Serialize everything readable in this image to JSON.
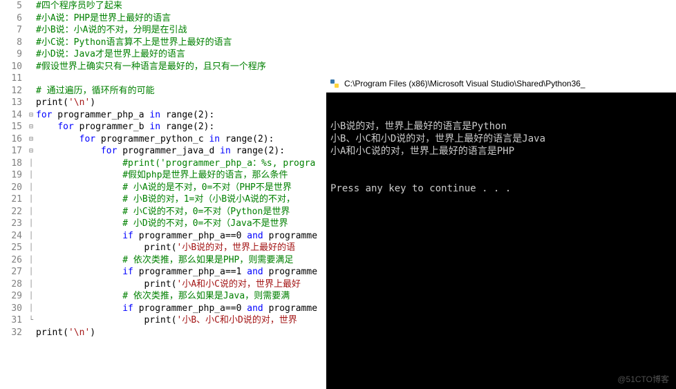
{
  "editor": {
    "lines": [
      {
        "num": 5,
        "fold": "",
        "seg": [
          {
            "cls": "c",
            "t": "#四个程序员吵了起来"
          }
        ]
      },
      {
        "num": 6,
        "fold": "",
        "seg": [
          {
            "cls": "c",
            "t": "#小A说：PHP是世界上最好的语言"
          }
        ]
      },
      {
        "num": 7,
        "fold": "",
        "seg": [
          {
            "cls": "c",
            "t": "#小B说：小A说的不对，分明是在引战"
          }
        ]
      },
      {
        "num": 8,
        "fold": "",
        "seg": [
          {
            "cls": "c",
            "t": "#小C说：Python语言算不上是世界上最好的语言"
          }
        ]
      },
      {
        "num": 9,
        "fold": "",
        "seg": [
          {
            "cls": "c",
            "t": "#小D说：Java才是世界上最好的语言"
          }
        ]
      },
      {
        "num": 10,
        "fold": "",
        "seg": [
          {
            "cls": "c",
            "t": "#假设世界上确实只有一种语言是最好的，且只有一个程序"
          }
        ]
      },
      {
        "num": 11,
        "fold": "",
        "seg": []
      },
      {
        "num": 12,
        "fold": "",
        "seg": [
          {
            "cls": "c",
            "t": "# 通过遍历，循环所有的可能"
          }
        ]
      },
      {
        "num": 13,
        "fold": "",
        "seg": [
          {
            "cls": "f",
            "t": "print"
          },
          {
            "cls": "op",
            "t": "("
          },
          {
            "cls": "s",
            "t": "'\\n'"
          },
          {
            "cls": "op",
            "t": ")"
          }
        ]
      },
      {
        "num": 14,
        "fold": "⊟",
        "seg": [
          {
            "cls": "k",
            "t": "for"
          },
          {
            "cls": "n",
            "t": " programmer_php_a "
          },
          {
            "cls": "k",
            "t": "in"
          },
          {
            "cls": "n",
            "t": " range"
          },
          {
            "cls": "op",
            "t": "("
          },
          {
            "cls": "num",
            "t": "2"
          },
          {
            "cls": "op",
            "t": "):"
          }
        ]
      },
      {
        "num": 15,
        "fold": "⊟",
        "seg": [
          {
            "cls": "n",
            "t": "    "
          },
          {
            "cls": "k",
            "t": "for"
          },
          {
            "cls": "n",
            "t": " programmer_b "
          },
          {
            "cls": "k",
            "t": "in"
          },
          {
            "cls": "n",
            "t": " range"
          },
          {
            "cls": "op",
            "t": "("
          },
          {
            "cls": "num",
            "t": "2"
          },
          {
            "cls": "op",
            "t": "):"
          }
        ]
      },
      {
        "num": 16,
        "fold": "⊟",
        "seg": [
          {
            "cls": "n",
            "t": "        "
          },
          {
            "cls": "k",
            "t": "for"
          },
          {
            "cls": "n",
            "t": " programmer_python_c "
          },
          {
            "cls": "k",
            "t": "in"
          },
          {
            "cls": "n",
            "t": " range"
          },
          {
            "cls": "op",
            "t": "("
          },
          {
            "cls": "num",
            "t": "2"
          },
          {
            "cls": "op",
            "t": "):"
          }
        ]
      },
      {
        "num": 17,
        "fold": "⊟",
        "seg": [
          {
            "cls": "n",
            "t": "            "
          },
          {
            "cls": "k",
            "t": "for"
          },
          {
            "cls": "n",
            "t": " programmer_java_d "
          },
          {
            "cls": "k",
            "t": "in"
          },
          {
            "cls": "n",
            "t": " range"
          },
          {
            "cls": "op",
            "t": "("
          },
          {
            "cls": "num",
            "t": "2"
          },
          {
            "cls": "op",
            "t": "):"
          }
        ]
      },
      {
        "num": 18,
        "fold": "│",
        "seg": [
          {
            "cls": "n",
            "t": "                "
          },
          {
            "cls": "c",
            "t": "#print('programmer_php_a：%s, progra"
          }
        ]
      },
      {
        "num": 19,
        "fold": "│",
        "seg": [
          {
            "cls": "n",
            "t": "                "
          },
          {
            "cls": "c",
            "t": "#假如php是世界上最好的语言，那么条件"
          }
        ]
      },
      {
        "num": 20,
        "fold": "│",
        "seg": [
          {
            "cls": "n",
            "t": "                "
          },
          {
            "cls": "c",
            "t": "# 小A说的是不对，0=不对（PHP不是世界"
          }
        ]
      },
      {
        "num": 21,
        "fold": "│",
        "seg": [
          {
            "cls": "n",
            "t": "                "
          },
          {
            "cls": "c",
            "t": "# 小B说的对，1=对（小B说小A说的不对，"
          }
        ]
      },
      {
        "num": 22,
        "fold": "│",
        "seg": [
          {
            "cls": "n",
            "t": "                "
          },
          {
            "cls": "c",
            "t": "# 小C说的不对，0=不对（Python是世界"
          }
        ]
      },
      {
        "num": 23,
        "fold": "│",
        "seg": [
          {
            "cls": "n",
            "t": "                "
          },
          {
            "cls": "c",
            "t": "# 小D说的不对，0=不对（Java不是世界"
          }
        ]
      },
      {
        "num": 24,
        "fold": "│",
        "seg": [
          {
            "cls": "n",
            "t": "                "
          },
          {
            "cls": "k",
            "t": "if"
          },
          {
            "cls": "n",
            "t": " programmer_php_a=="
          },
          {
            "cls": "num",
            "t": "0"
          },
          {
            "cls": "n",
            "t": " "
          },
          {
            "cls": "k",
            "t": "and"
          },
          {
            "cls": "n",
            "t": " programme"
          }
        ]
      },
      {
        "num": 25,
        "fold": "│",
        "seg": [
          {
            "cls": "n",
            "t": "                    "
          },
          {
            "cls": "f",
            "t": "print"
          },
          {
            "cls": "op",
            "t": "("
          },
          {
            "cls": "s",
            "t": "'小B说的对，世界上最好的语"
          }
        ]
      },
      {
        "num": 26,
        "fold": "│",
        "seg": [
          {
            "cls": "n",
            "t": "                "
          },
          {
            "cls": "c",
            "t": "# 依次类推，那么如果是PHP，则需要满足"
          }
        ]
      },
      {
        "num": 27,
        "fold": "│",
        "seg": [
          {
            "cls": "n",
            "t": "                "
          },
          {
            "cls": "k",
            "t": "if"
          },
          {
            "cls": "n",
            "t": " programmer_php_a=="
          },
          {
            "cls": "num",
            "t": "1"
          },
          {
            "cls": "n",
            "t": " "
          },
          {
            "cls": "k",
            "t": "and"
          },
          {
            "cls": "n",
            "t": " programme"
          }
        ]
      },
      {
        "num": 28,
        "fold": "│",
        "seg": [
          {
            "cls": "n",
            "t": "                    "
          },
          {
            "cls": "f",
            "t": "print"
          },
          {
            "cls": "op",
            "t": "("
          },
          {
            "cls": "s",
            "t": "'小A和小C说的对，世界上最好"
          }
        ]
      },
      {
        "num": 29,
        "fold": "│",
        "seg": [
          {
            "cls": "n",
            "t": "                "
          },
          {
            "cls": "c",
            "t": "# 依次类推，那么如果是Java，则需要满"
          }
        ]
      },
      {
        "num": 30,
        "fold": "│",
        "seg": [
          {
            "cls": "n",
            "t": "                "
          },
          {
            "cls": "k",
            "t": "if"
          },
          {
            "cls": "n",
            "t": " programmer_php_a=="
          },
          {
            "cls": "num",
            "t": "0"
          },
          {
            "cls": "n",
            "t": " "
          },
          {
            "cls": "k",
            "t": "and"
          },
          {
            "cls": "n",
            "t": " programme"
          }
        ]
      },
      {
        "num": 31,
        "fold": "└",
        "seg": [
          {
            "cls": "n",
            "t": "                    "
          },
          {
            "cls": "f",
            "t": "print"
          },
          {
            "cls": "op",
            "t": "("
          },
          {
            "cls": "s",
            "t": "'小B、小C和小D说的对，世界"
          }
        ]
      },
      {
        "num": 32,
        "fold": "",
        "seg": [
          {
            "cls": "f",
            "t": "print"
          },
          {
            "cls": "op",
            "t": "("
          },
          {
            "cls": "s",
            "t": "'\\n'"
          },
          {
            "cls": "op",
            "t": ")"
          }
        ]
      }
    ]
  },
  "terminal": {
    "title": "C:\\Program Files (x86)\\Microsoft Visual Studio\\Shared\\Python36_",
    "output": [
      "",
      "",
      "小B说的对，世界上最好的语言是Python",
      "小B、小C和小D说的对，世界上最好的语言是Java",
      "小A和小C说的对，世界上最好的语言是PHP",
      "",
      "",
      "Press any key to continue . . ."
    ]
  },
  "watermark": "@51CTO博客"
}
